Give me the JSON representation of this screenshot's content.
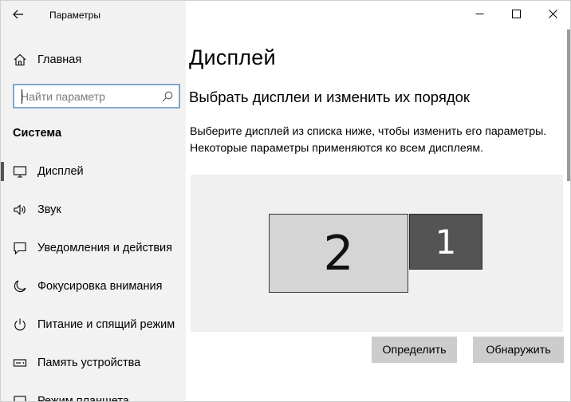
{
  "window": {
    "title": "Параметры"
  },
  "window_controls": {
    "minimize": "—",
    "maximize": "☐",
    "close": "✕"
  },
  "sidebar": {
    "home_label": "Главная",
    "search_placeholder": "Найти параметр",
    "section_title": "Система",
    "items": [
      {
        "label": "Дисплей",
        "icon": "monitor-icon",
        "selected": true
      },
      {
        "label": "Звук",
        "icon": "speaker-icon",
        "selected": false
      },
      {
        "label": "Уведомления и действия",
        "icon": "notification-icon",
        "selected": false
      },
      {
        "label": "Фокусировка внимания",
        "icon": "moon-icon",
        "selected": false
      },
      {
        "label": "Питание и спящий режим",
        "icon": "power-icon",
        "selected": false
      },
      {
        "label": "Память устройства",
        "icon": "storage-icon",
        "selected": false
      },
      {
        "label": "Режим планшета",
        "icon": "tablet-icon",
        "selected": false
      }
    ]
  },
  "main": {
    "title": "Дисплей",
    "subtitle": "Выбрать дисплеи и изменить их порядок",
    "description_line1": "Выберите дисплей из списка ниже, чтобы изменить его параметры.",
    "description_line2": "Некоторые параметры применяются ко всем дисплеям.",
    "monitors": [
      {
        "number": "2",
        "selected": false
      },
      {
        "number": "1",
        "selected": true
      }
    ],
    "identify_button": "Определить",
    "detect_button": "Обнаружить"
  }
}
